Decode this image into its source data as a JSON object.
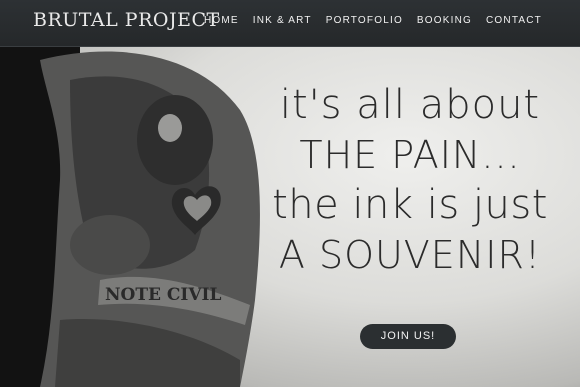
{
  "header": {
    "logo": "BRUTAL PROJECT",
    "nav": [
      {
        "label": "HOME"
      },
      {
        "label": "INK & ART"
      },
      {
        "label": "PORTOFOLIO"
      },
      {
        "label": "BOOKING"
      },
      {
        "label": "CONTACT"
      }
    ]
  },
  "hero": {
    "line1": "it's all about",
    "line2": "THE PAIN...",
    "line3": "the ink is just",
    "line4": "A SOUVENIR!",
    "cta_label": "JOIN US!",
    "image_subject": "tattooed-arm-photo",
    "tattoo_banner_text": "NOTE CIVIL"
  },
  "colors": {
    "header_bg": "#2d3134",
    "cta_bg": "#2b2f31",
    "text": "#2b2b2b"
  }
}
